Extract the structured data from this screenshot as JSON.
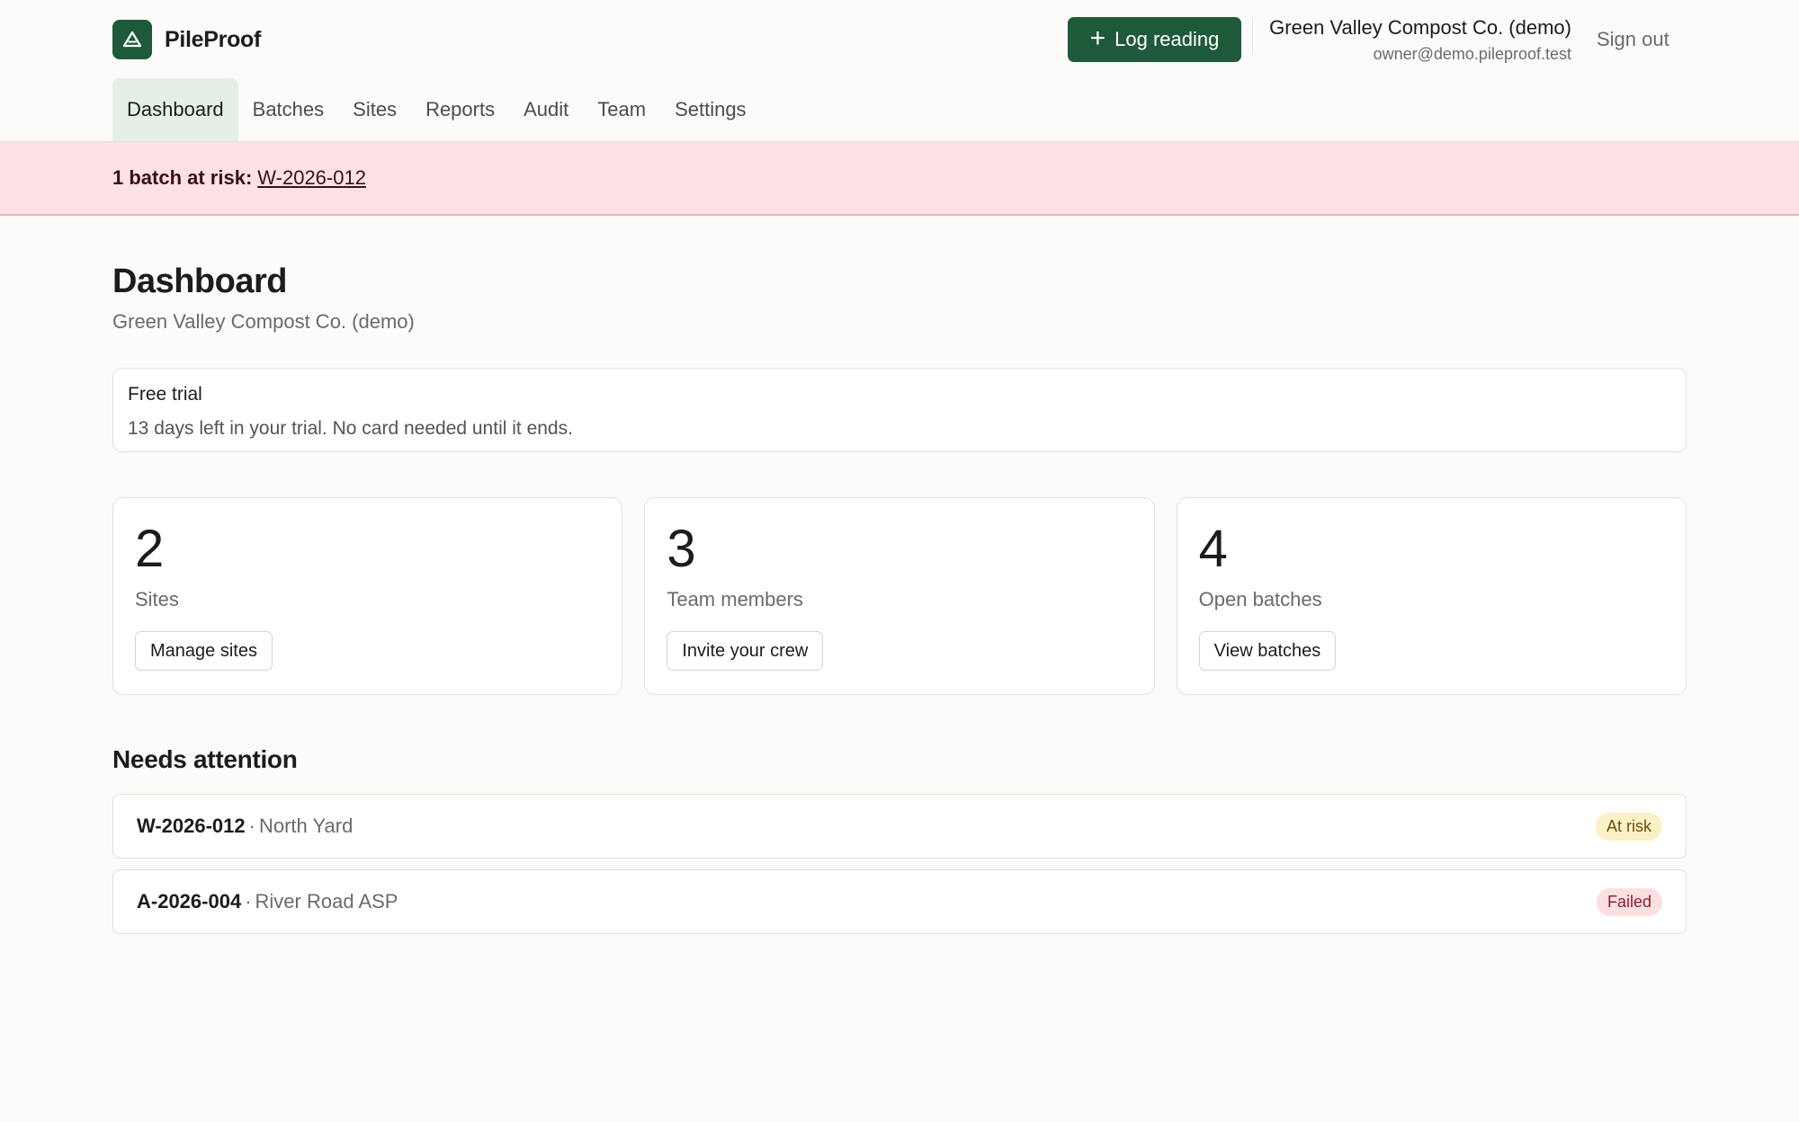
{
  "app": {
    "name": "PileProof",
    "logo_icon": "triangle-icon"
  },
  "header": {
    "log_reading_label": "Log reading",
    "org_name": "Green Valley Compost Co. (demo)",
    "user_email": "owner@demo.pileproof.test",
    "sign_out_label": "Sign out"
  },
  "nav": {
    "items": [
      {
        "label": "Dashboard",
        "active": true
      },
      {
        "label": "Batches"
      },
      {
        "label": "Sites"
      },
      {
        "label": "Reports"
      },
      {
        "label": "Audit"
      },
      {
        "label": "Team"
      },
      {
        "label": "Settings"
      }
    ]
  },
  "alert": {
    "label": "1 batch at risk:",
    "link": "W-2026-012"
  },
  "page": {
    "title": "Dashboard",
    "subtitle": "Green Valley Compost Co. (demo)"
  },
  "trial": {
    "title": "Free trial",
    "text": "13 days left in your trial. No card needed until it ends."
  },
  "stats": [
    {
      "value": "2",
      "label": "Sites",
      "button": "Manage sites"
    },
    {
      "value": "3",
      "label": "Team members",
      "button": "Invite your crew"
    },
    {
      "value": "4",
      "label": "Open batches",
      "button": "View batches"
    }
  ],
  "attention": {
    "title": "Needs attention",
    "items": [
      {
        "id": "W-2026-012",
        "sep": "·",
        "site": "North Yard",
        "status": "At risk"
      },
      {
        "id": "A-2026-004",
        "sep": "·",
        "site": "River Road ASP",
        "status": "Failed"
      }
    ]
  },
  "colors": {
    "brand": "#1e5a3a",
    "alert_bg": "#fde1e4",
    "at_risk_bg": "#fcf0c6",
    "at_risk_text": "#6b4e0a",
    "failed_bg": "#fbe0e2",
    "failed_text": "#8a1f28"
  }
}
